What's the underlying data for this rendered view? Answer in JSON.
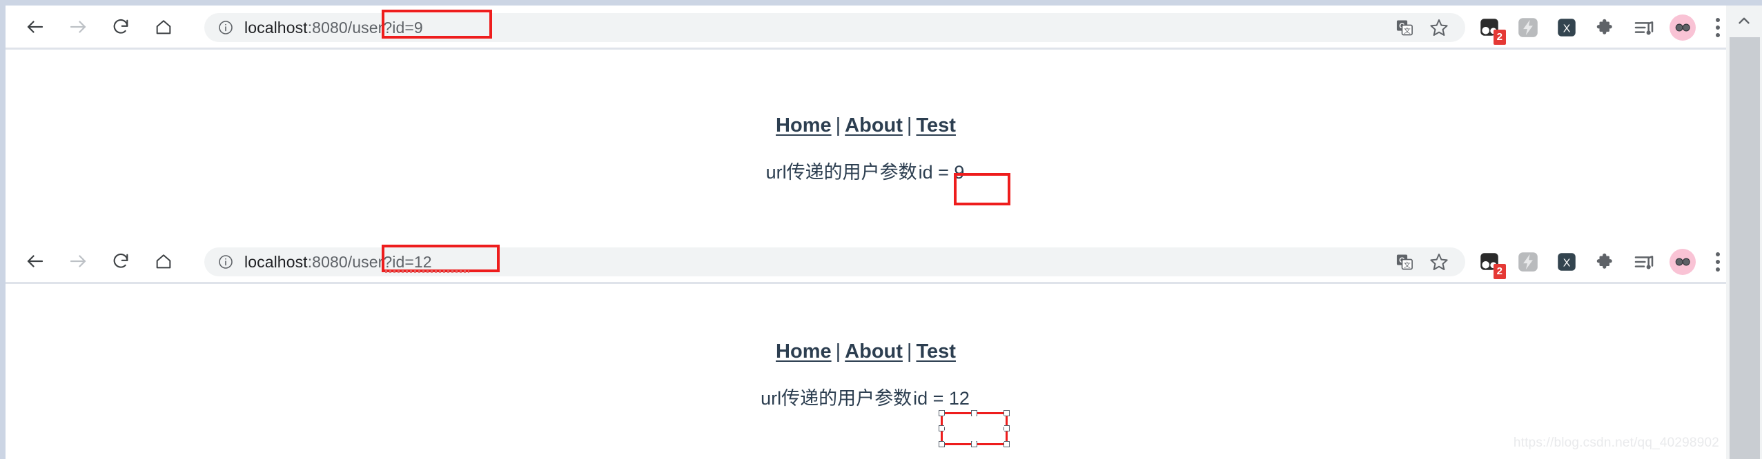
{
  "colors": {
    "chrome_edge": "#ccd5e4",
    "omnibox_bg": "#f1f3f4",
    "annotation_red": "#ee1d1d",
    "link_navy": "#2c3e50",
    "badge_red": "#e53935",
    "avatar_pink": "#f9c3d5",
    "url_dim": "#5f6368"
  },
  "windows": [
    {
      "toolbar": {
        "back_label": "back-arrow",
        "forward_label": "forward-arrow",
        "reload_label": "reload",
        "home_label": "home",
        "site_info_label": "site-information",
        "url": {
          "host": "localhost",
          "port": ":8080",
          "separator": "/",
          "path": "user?id=9",
          "full": "localhost:8080/user?id=9"
        },
        "translate_label": "translate",
        "bookmark_label": "bookmark-star",
        "extensions": [
          {
            "name": "dark-eyes-extension",
            "badge": "2"
          },
          {
            "name": "lightning-extension",
            "badge": ""
          },
          {
            "name": "x-extension",
            "badge": ""
          },
          {
            "name": "puzzle-extension",
            "badge": ""
          },
          {
            "name": "music-playlist-extension",
            "badge": ""
          }
        ],
        "avatar_label": "profile-avatar",
        "menu_label": "chrome-menu"
      },
      "page": {
        "nav": [
          {
            "label": "Home"
          },
          {
            "label": "About"
          },
          {
            "label": "Test"
          }
        ],
        "nav_separator": "|",
        "content_prefix": "url传递的用户参数",
        "content_param": "id = 9"
      }
    },
    {
      "toolbar": {
        "back_label": "back-arrow",
        "forward_label": "forward-arrow",
        "reload_label": "reload",
        "home_label": "home",
        "site_info_label": "site-information",
        "url": {
          "host": "localhost",
          "port": ":8080",
          "separator": "/",
          "path": "user?id=12",
          "full": "localhost:8080/user?id=12"
        },
        "translate_label": "translate",
        "bookmark_label": "bookmark-star",
        "extensions": [
          {
            "name": "dark-eyes-extension",
            "badge": "2"
          },
          {
            "name": "lightning-extension",
            "badge": ""
          },
          {
            "name": "x-extension",
            "badge": ""
          },
          {
            "name": "puzzle-extension",
            "badge": ""
          },
          {
            "name": "music-playlist-extension",
            "badge": ""
          }
        ],
        "avatar_label": "profile-avatar",
        "menu_label": "chrome-menu"
      },
      "page": {
        "nav": [
          {
            "label": "Home"
          },
          {
            "label": "About"
          },
          {
            "label": "Test"
          }
        ],
        "nav_separator": "|",
        "content_prefix": "url传递的用户参数",
        "content_param": "id = 12"
      }
    }
  ],
  "watermark": "https://blog.csdn.net/qq_40298902"
}
